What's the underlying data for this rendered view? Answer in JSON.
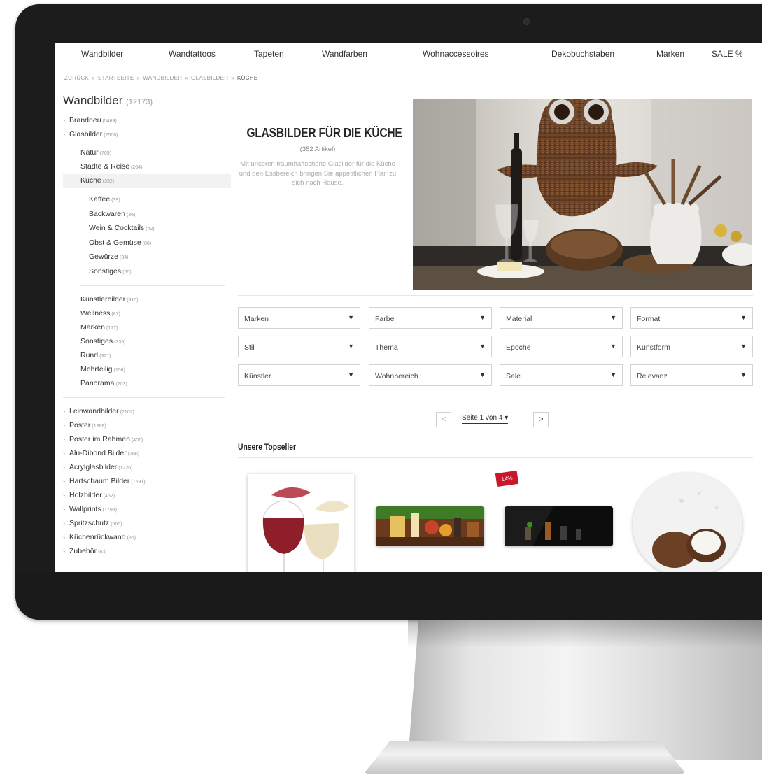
{
  "nav": [
    "Wandbilder",
    "Wandtattoos",
    "Tapeten",
    "Wandfarben",
    "Wohnaccessoires",
    "Dekobuchstaben",
    "Marken",
    "SALE %"
  ],
  "breadcrumb": [
    "ZURÜCK",
    "STARTSEITE",
    "WANDBILDER",
    "GLASBILDER",
    "KÜCHE"
  ],
  "sidebar": {
    "title": "Wandbilder",
    "title_count": "(12173)",
    "top": [
      {
        "label": "Brandneu",
        "count": "(5469)"
      },
      {
        "label": "Glasbilder",
        "count": "(2506)"
      }
    ],
    "glas": [
      {
        "label": "Natur",
        "count": "(705)"
      },
      {
        "label": "Städte & Reise",
        "count": "(264)"
      },
      {
        "label": "Küche",
        "count": "(352)"
      }
    ],
    "kueche": [
      {
        "label": "Kaffee",
        "count": "(39)"
      },
      {
        "label": "Backwaren",
        "count": "(36)"
      },
      {
        "label": "Wein & Cocktails",
        "count": "(42)"
      },
      {
        "label": "Obst & Gemüse",
        "count": "(86)"
      },
      {
        "label": "Gewürze",
        "count": "(34)"
      },
      {
        "label": "Sonstiges",
        "count": "(55)"
      }
    ],
    "glas2": [
      {
        "label": "Künstlerbilder",
        "count": "(910)"
      },
      {
        "label": "Wellness",
        "count": "(87)"
      },
      {
        "label": "Marken",
        "count": "(177)"
      },
      {
        "label": "Sonstiges",
        "count": "(335)"
      },
      {
        "label": "Rund",
        "count": "(321)"
      },
      {
        "label": "Mehrteilig",
        "count": "(156)"
      },
      {
        "label": "Panorama",
        "count": "(203)"
      }
    ],
    "rest": [
      {
        "label": "Leinwandbilder",
        "count": "(2102)"
      },
      {
        "label": "Poster",
        "count": "(1868)"
      },
      {
        "label": "Poster im Rahmen",
        "count": "(406)"
      },
      {
        "label": "Alu-Dibond Bilder",
        "count": "(260)"
      },
      {
        "label": "Acrylglasbilder",
        "count": "(1226)"
      },
      {
        "label": "Hartschaum Bilder",
        "count": "(1591)"
      },
      {
        "label": "Holzbilder",
        "count": "(462)"
      },
      {
        "label": "Wallprints",
        "count": "(1793)"
      },
      {
        "label": "Spritzschutz",
        "count": "(665)"
      },
      {
        "label": "Küchenrückwand",
        "count": "(85)"
      },
      {
        "label": "Zubehör",
        "count": "(63)"
      }
    ]
  },
  "hero": {
    "title": "GLASBILDER FÜR DIE KÜCHE",
    "subtitle": "(352 Artikel)",
    "description": "Mit unseren traumhaftschöne Glasilder für die Küche und den Essbereich bringen Sie appetitlichen Flair zu sich nach Hause."
  },
  "filters": [
    "Marken",
    "Farbe",
    "Material",
    "Format",
    "Stil",
    "Thema",
    "Epoche",
    "Kunstform",
    "Künstler",
    "Wohnbereich",
    "Sale",
    "Relevanz"
  ],
  "pagination": {
    "label": "Seite 1 von 4",
    "prev": "<",
    "next": ">"
  },
  "topseller_title": "Unsere Topseller",
  "badge": "14%",
  "colors": {
    "badge": "#c9182b",
    "text": "#333333",
    "muted": "#999999",
    "frame": "#1c1c1c"
  }
}
